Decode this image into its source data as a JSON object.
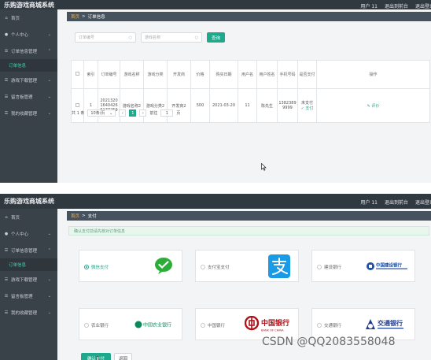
{
  "app_title": "乐购游戏商城系统",
  "top_nav": [
    "用户 11",
    "退出到前台",
    "退出登录"
  ],
  "sidebar": {
    "items": [
      {
        "label": "首页",
        "icon": "home-icon"
      },
      {
        "label": "个人中心",
        "icon": "user-icon"
      },
      {
        "label": "订单信息管理",
        "icon": "list-icon"
      },
      {
        "label": "游戏下载管理",
        "icon": "list-icon"
      },
      {
        "label": "留言板管理",
        "icon": "list-icon"
      },
      {
        "label": "我的收藏管理",
        "icon": "list-icon"
      }
    ],
    "sub_item": "订单信息"
  },
  "screen1": {
    "breadcrumb": [
      "首页",
      "订单信息"
    ],
    "search": {
      "order_placeholder": "订单编号",
      "game_placeholder": "游戏名称",
      "button": "查询"
    },
    "table": {
      "headers": [
        "索引",
        "订单编号",
        "游戏名称",
        "游戏分类",
        "开发商",
        "价格",
        "购买日期",
        "用户名",
        "用户姓名",
        "手机号码",
        "是否支付",
        "操作"
      ],
      "rows": [
        {
          "index": "1",
          "order_no": "2021320164042651772​59",
          "game": "游戏名称2",
          "category": "游戏分类2",
          "developer": "开发商2",
          "price": "500",
          "date": "2021-03-20",
          "username": "11",
          "name": "陈先生",
          "phone": "13823899999",
          "paid": "未支付",
          "pay_link": "支付",
          "action": "评价"
        }
      ]
    },
    "pager": {
      "total": "共 1 条",
      "page_size": "10条/页",
      "page": "1",
      "goto_label": "前往",
      "goto_value": "1",
      "goto_suffix": "页"
    }
  },
  "screen2": {
    "breadcrumb": [
      "首页",
      "支付"
    ],
    "notice": "确认支付前请先核对订单信息",
    "payments": [
      {
        "label": "微信支付",
        "logo": "wechat-pay-logo",
        "selected": true
      },
      {
        "label": "支付宝支付",
        "logo": "alipay-logo",
        "selected": false
      },
      {
        "label": "建设银行",
        "logo": "ccb-logo",
        "logo_text": "中国建设银行",
        "selected": false
      },
      {
        "label": "农业银行",
        "logo": "abc-logo",
        "logo_text": "中国农业银行",
        "selected": false
      },
      {
        "label": "中国银行",
        "logo": "boc-logo",
        "logo_text": "中国银行",
        "logo_sub": "BANK OF CHINA",
        "selected": false
      },
      {
        "label": "交通银行",
        "logo": "bocom-logo",
        "logo_text": "交通银行",
        "selected": false
      }
    ],
    "confirm_button": "确认支付",
    "back_button": "返回"
  },
  "watermark": "CSDN @QQ2083558048",
  "colors": {
    "accent": "#1ea98c",
    "topbar": "#303840",
    "sidebar": "#3a4249"
  }
}
